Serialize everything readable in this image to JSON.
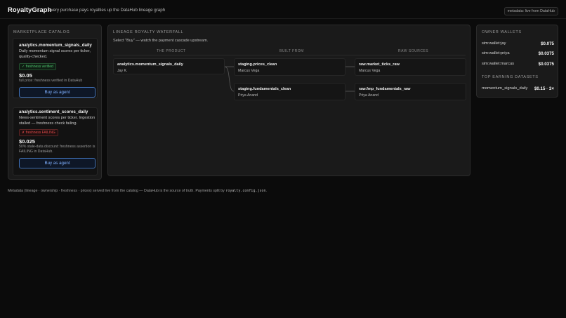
{
  "header": {
    "brand": "RoyaltyGraph",
    "tagline": "every purchase pays royalties up the DataHub lineage graph",
    "live_pill": "metadata: live from DataHub"
  },
  "catalog": {
    "title": "MARKETPLACE CATALOG",
    "items": [
      {
        "name": "analytics.momentum_signals_daily",
        "description": "Daily momentum signal scores per ticker, quality-checked.",
        "badge": "✓ freshness verified",
        "badge_status": "ok",
        "price": "$0.05",
        "price_note": "full price: freshness verified in DataHub",
        "buy_label": "Buy as agent"
      },
      {
        "name": "analytics.sentiment_scores_daily",
        "description": "News-sentiment scores per ticker. Ingestion stalled — freshness check failing.",
        "badge": "✗ freshness FAILING",
        "badge_status": "fail",
        "price": "$0.025",
        "price_note": "50% stale-data discount: freshness assertion is FAILING in DataHub.",
        "buy_label": "Buy as agent"
      }
    ]
  },
  "waterfall": {
    "title": "LINEAGE ROYALTY WATERFALL",
    "subtitle": "Select \"Buy\" — watch the payment cascade upstream.",
    "columns": [
      "THE PRODUCT",
      "BUILT FROM",
      "RAW SOURCES"
    ],
    "product": {
      "name": "analytics.momentum_signals_daily",
      "owner": "Jay K."
    },
    "built_from": [
      {
        "name": "staging.prices_clean",
        "owner": "Marcus Vega"
      },
      {
        "name": "staging.fundamentals_clean",
        "owner": "Priya Anand"
      }
    ],
    "raw_sources": [
      {
        "name": "raw.market_ticks_raw",
        "owner": "Marcus Vega"
      },
      {
        "name": "raw.fmp_fundamentals_raw",
        "owner": "Priya Anand"
      }
    ]
  },
  "wallets": {
    "title": "OWNER WALLETS",
    "rows": [
      {
        "name": "sim:wallet:jay",
        "amount": "$0.075"
      },
      {
        "name": "sim:wallet:priya",
        "amount": "$0.0375"
      },
      {
        "name": "sim:wallet:marcus",
        "amount": "$0.0375"
      }
    ],
    "top_title": "TOP EARNING DATASETS",
    "top_rows": [
      {
        "name": "momentum_signals_daily",
        "amount": "$0.15 · 3×"
      }
    ]
  },
  "footer": {
    "text": "Metadata (lineage · ownership · freshness · prices) served live from the catalog — DataHub is the source of truth. Payments split by ",
    "code": "royalty.config.json",
    "end": "."
  },
  "colors": {
    "accent_blue": "#3f6fb3",
    "ok_green": "#4fc46e",
    "fail_red": "#e24a4a",
    "background": "#0b0b0b"
  }
}
